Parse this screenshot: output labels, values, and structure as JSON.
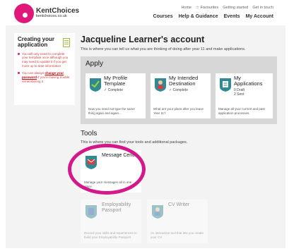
{
  "header": {
    "logo_title": "KentChoices",
    "logo_url": "kentchoices.co.uk",
    "top_links": [
      "Home",
      "☆ Favourites",
      "Getting started",
      "Get in touch"
    ],
    "main_nav": [
      "Courses",
      "Help & Guidance",
      "Events",
      "My Account"
    ]
  },
  "sidebar": {
    "title": "Creating your application",
    "items": [
      {
        "text": "You will only need to complete your template once although you may need to update it if you get more up to date information"
      },
      {
        "pre": "You can always ",
        "link": "change your password",
        "post": " if you're having trouble remembering it"
      }
    ]
  },
  "main": {
    "title": "Jacqueline Learner's account",
    "subtitle": "This is where you can tell us what you are thinking of doing after year 11 and make applications."
  },
  "apply": {
    "title": "Apply",
    "cards": [
      {
        "name": "My Profile Template",
        "status": "✓ Complete",
        "desc": "Now you need not type the same thing again and again..."
      },
      {
        "name": "My Intended Destination",
        "status": "✓ Complete",
        "desc": "What are your plans after you leave Year 11?"
      },
      {
        "name": "My Applications",
        "status_lines": [
          "0 Draft",
          "2 Sent"
        ],
        "desc": "Manage all your current and past application processes."
      }
    ]
  },
  "tools": {
    "title": "Tools",
    "subtitle": "This is where you can find your tools and additional packages.",
    "items": [
      {
        "name": "Message Centre",
        "desc": "Manage your messages all in one place"
      },
      {
        "name": "Employability Passport",
        "desc": "Record your skills and experiences to build your Employability Passport"
      },
      {
        "name": "CV Writer",
        "desc": "An interactive tool that lets you create your CV"
      }
    ]
  },
  "colors": {
    "brand": "#e0187a",
    "annotation": "#d4188a",
    "badge": "#2f8a94",
    "panel": "#d7d7d7"
  }
}
